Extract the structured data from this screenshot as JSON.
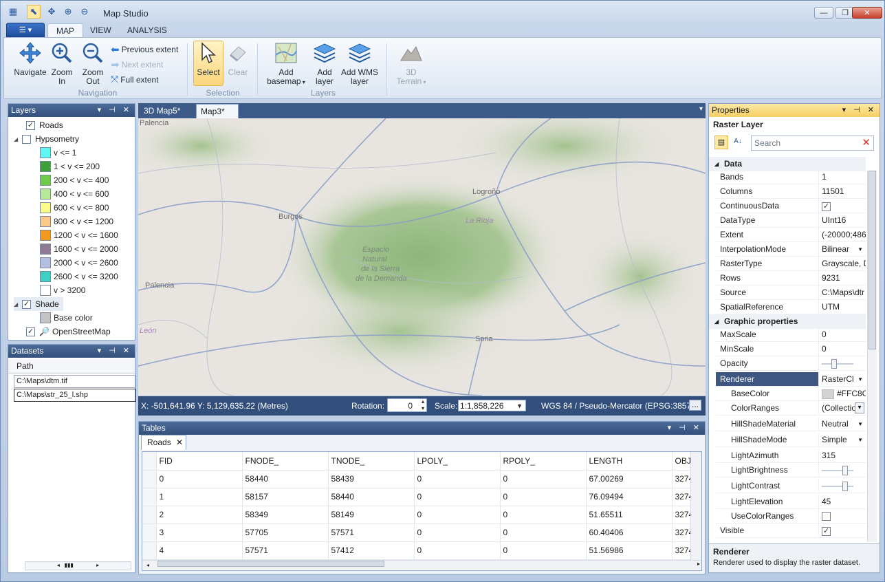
{
  "window": {
    "title": "Map Studio"
  },
  "ribbon": {
    "tabs": [
      "MAP",
      "VIEW",
      "ANALYSIS"
    ],
    "navigation": {
      "navigate": "Navigate",
      "zoom_in": "Zoom\nIn",
      "zoom_out": "Zoom\nOut",
      "previous_extent": "Previous extent",
      "next_extent": "Next extent",
      "full_extent": "Full extent",
      "group": "Navigation"
    },
    "selection": {
      "select": "Select",
      "clear": "Clear",
      "group": "Selection"
    },
    "layers": {
      "add_basemap": "Add\nbasemap",
      "add_layer": "Add\nlayer",
      "add_wms": "Add WMS\nlayer",
      "group": "Layers"
    },
    "terrain": {
      "label": "3D\nTerrain"
    }
  },
  "layers_panel": {
    "title": "Layers",
    "items": [
      {
        "label": "Roads",
        "checked": true
      },
      {
        "label": "Hypsometry",
        "checked": false
      },
      {
        "label": "Shade",
        "checked": true
      },
      {
        "label": "OpenStreetMap",
        "checked": true
      }
    ],
    "legend": [
      {
        "label": "v <= 1",
        "color": "#5ff7f2"
      },
      {
        "label": "1 < v <= 200",
        "color": "#3fa03a"
      },
      {
        "label": "200 < v <= 400",
        "color": "#6fcc4a"
      },
      {
        "label": "400 < v <= 600",
        "color": "#b8e89a"
      },
      {
        "label": "600 < v <= 800",
        "color": "#fbfb8c"
      },
      {
        "label": "800 < v <= 1200",
        "color": "#fbc98a"
      },
      {
        "label": "1200 < v <= 1600",
        "color": "#f29a1e"
      },
      {
        "label": "1600 < v <= 2000",
        "color": "#8f7a93"
      },
      {
        "label": "2000 < v <= 2600",
        "color": "#b5bfe4"
      },
      {
        "label": "2600 < v <= 3200",
        "color": "#3ed0c2"
      },
      {
        "label": "v > 3200",
        "color": "#ffffff"
      }
    ],
    "shade_base": {
      "label": "Base color",
      "color": "#c4c4c4"
    }
  },
  "datasets_panel": {
    "title": "Datasets",
    "column": "Path",
    "rows": [
      "C:\\Maps\\dtm.tif",
      "C:\\Maps\\str_25_l.shp"
    ]
  },
  "doc_tabs": [
    {
      "label": "3D Map5*"
    },
    {
      "label": "Map3*"
    }
  ],
  "map": {
    "labels": [
      "Palencia",
      "Burgos",
      "Logroño",
      "La Rioja",
      "Espacio",
      "Natural",
      "de la Sierra",
      "de la Demanda",
      "Palencia",
      "León",
      "Soria"
    ]
  },
  "map_status": {
    "coords": "X: -501,641.96  Y: 5,129,635.22 (Metres)",
    "rotation_label": "Rotation:",
    "rotation": "0",
    "scale_label": "Scale:",
    "scale": "1:1,858,226",
    "crs": "WGS 84 / Pseudo-Mercator (EPSG:3857)",
    "more": "..."
  },
  "tables_panel": {
    "title": "Tables",
    "tab": "Roads",
    "columns": [
      "FID",
      "FNODE_",
      "TNODE_",
      "LPOLY_",
      "RPOLY_",
      "LENGTH",
      "OBJ"
    ],
    "rows": [
      [
        "0",
        "58440",
        "58439",
        "0",
        "0",
        "67.00269",
        "3274"
      ],
      [
        "1",
        "58157",
        "58440",
        "0",
        "0",
        "76.09494",
        "3274"
      ],
      [
        "2",
        "58349",
        "58149",
        "0",
        "0",
        "51.65511",
        "3274"
      ],
      [
        "3",
        "57705",
        "57571",
        "0",
        "0",
        "60.40406",
        "3274"
      ],
      [
        "4",
        "57571",
        "57412",
        "0",
        "0",
        "51.56986",
        "3274"
      ]
    ]
  },
  "properties_panel": {
    "title": "Properties",
    "object": "Raster Layer",
    "search_placeholder": "Search",
    "cat_data": "Data",
    "cat_graphic": "Graphic properties",
    "data": [
      {
        "k": "Bands",
        "v": "1"
      },
      {
        "k": "Columns",
        "v": "11501"
      },
      {
        "k": "ContinuousData",
        "v": "✓"
      },
      {
        "k": "DataType",
        "v": "UInt16"
      },
      {
        "k": "Extent",
        "v": "(-20000;486"
      },
      {
        "k": "InterpolationMode",
        "v": "Bilinear"
      },
      {
        "k": "RasterType",
        "v": "Grayscale, D"
      },
      {
        "k": "Rows",
        "v": "9231"
      },
      {
        "k": "Source",
        "v": "C:\\Maps\\dtr"
      },
      {
        "k": "SpatialReference",
        "v": "UTM"
      }
    ],
    "graphic": [
      {
        "k": "MaxScale",
        "v": "0"
      },
      {
        "k": "MinScale",
        "v": "0"
      },
      {
        "k": "Opacity",
        "v": ""
      },
      {
        "k": "Renderer",
        "v": "RasterCl"
      },
      {
        "k": "BaseColor",
        "v": "#FFC8C"
      },
      {
        "k": "ColorRanges",
        "v": "(Collectio"
      },
      {
        "k": "HillShadeMaterial",
        "v": "Neutral"
      },
      {
        "k": "HillShadeMode",
        "v": "Simple"
      },
      {
        "k": "LightAzimuth",
        "v": "315"
      },
      {
        "k": "LightBrightness",
        "v": ""
      },
      {
        "k": "LightContrast",
        "v": ""
      },
      {
        "k": "LightElevation",
        "v": "45"
      },
      {
        "k": "UseColorRanges",
        "v": ""
      },
      {
        "k": "Visible",
        "v": "✓"
      }
    ],
    "desc_title": "Renderer",
    "desc_text": "Renderer used to display the raster dataset."
  }
}
